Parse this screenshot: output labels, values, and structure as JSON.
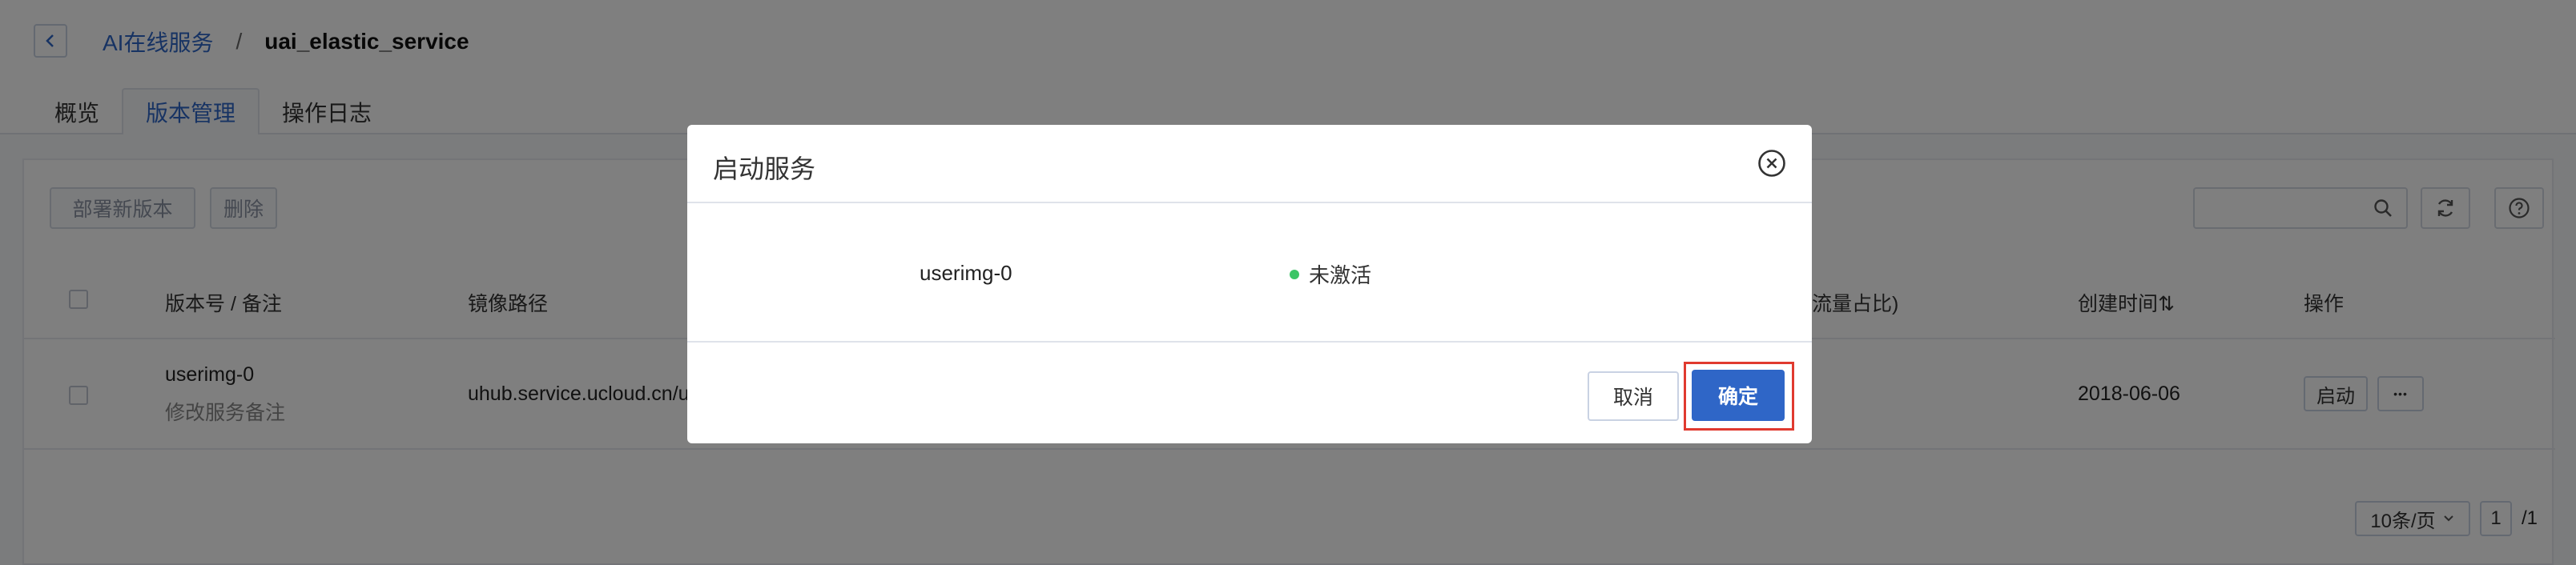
{
  "breadcrumb": {
    "parent": "AI在线服务",
    "separator": "/",
    "current": "uai_elastic_service"
  },
  "tabs": [
    {
      "label": "概览"
    },
    {
      "label": "版本管理"
    },
    {
      "label": "操作日志"
    }
  ],
  "toolbar": {
    "deploy_label": "部署新版本",
    "delete_label": "删除",
    "search_placeholder": ""
  },
  "table": {
    "headers": {
      "version": "版本号 / 备注",
      "image_path": "镜像路径",
      "traffic": "流量占比)",
      "created": "创建时间⇅",
      "actions": "操作"
    },
    "rows": [
      {
        "version": "userimg-0",
        "note_link": "修改服务备注",
        "image_path": "uhub.service.ucloud.cn/ua",
        "created": "2018-06-06",
        "start_label": "启动",
        "more_label": "•••"
      }
    ]
  },
  "pagination": {
    "page_size": "10条/页",
    "current_page": "1",
    "total": "/1"
  },
  "modal": {
    "title": "启动服务",
    "item_name": "userimg-0",
    "item_status": "未激活",
    "cancel_label": "取消",
    "confirm_label": "确定"
  },
  "colors": {
    "accent": "#2f66c7",
    "status_inactive_dot": "#3cc566",
    "highlight_frame": "#e03a2f"
  },
  "icons": [
    "chevron-left-icon",
    "search-icon",
    "refresh-icon",
    "help-icon",
    "close-icon",
    "chevron-down-icon"
  ]
}
